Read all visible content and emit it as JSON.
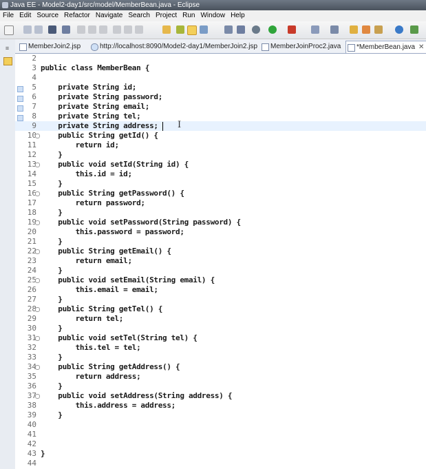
{
  "window": {
    "title": "Java EE - Model2-day1/src/model/MemberBean.java - Eclipse"
  },
  "menu": [
    "File",
    "Edit",
    "Source",
    "Refactor",
    "Navigate",
    "Search",
    "Project",
    "Run",
    "Window",
    "Help"
  ],
  "tabs": [
    {
      "label": "MemberJoin2.jsp",
      "active": false,
      "icon": "jsp-file-icon"
    },
    {
      "label": "http://localhost:8090/Model2-day1/MemberJoin2.jsp",
      "active": false,
      "icon": "web-browser-icon"
    },
    {
      "label": "MemberJoinProc2.java",
      "active": false,
      "icon": "java-file-icon"
    },
    {
      "label": "*MemberBean.java",
      "active": true,
      "icon": "java-file-icon",
      "close": "✕"
    }
  ],
  "colors": {
    "keyword": "#1a1a1a",
    "line_numbers": "#6a6a6a",
    "current_line": "#e8f2fe",
    "titlebar": "#4a525d"
  },
  "editor": {
    "current_line": 9,
    "lines": [
      {
        "n": "2",
        "code": ""
      },
      {
        "n": "3",
        "code": "public class MemberBean {"
      },
      {
        "n": "4",
        "code": ""
      },
      {
        "n": "5",
        "code": "    private String id;"
      },
      {
        "n": "6",
        "code": "    private String password;"
      },
      {
        "n": "7",
        "code": "    private String email;"
      },
      {
        "n": "8",
        "code": "    private String tel;"
      },
      {
        "n": "9",
        "code": "    private String address;"
      },
      {
        "n": "10",
        "code": "    public String getId() {",
        "fold": true
      },
      {
        "n": "11",
        "code": "        return id;"
      },
      {
        "n": "12",
        "code": "    }"
      },
      {
        "n": "13",
        "code": "    public void setId(String id) {",
        "fold": true
      },
      {
        "n": "14",
        "code": "        this.id = id;"
      },
      {
        "n": "15",
        "code": "    }"
      },
      {
        "n": "16",
        "code": "    public String getPassword() {",
        "fold": true
      },
      {
        "n": "17",
        "code": "        return password;"
      },
      {
        "n": "18",
        "code": "    }"
      },
      {
        "n": "19",
        "code": "    public void setPassword(String password) {",
        "fold": true
      },
      {
        "n": "20",
        "code": "        this.password = password;"
      },
      {
        "n": "21",
        "code": "    }"
      },
      {
        "n": "22",
        "code": "    public String getEmail() {",
        "fold": true
      },
      {
        "n": "23",
        "code": "        return email;"
      },
      {
        "n": "24",
        "code": "    }"
      },
      {
        "n": "25",
        "code": "    public void setEmail(String email) {",
        "fold": true
      },
      {
        "n": "26",
        "code": "        this.email = email;"
      },
      {
        "n": "27",
        "code": "    }"
      },
      {
        "n": "28",
        "code": "    public String getTel() {",
        "fold": true
      },
      {
        "n": "29",
        "code": "        return tel;"
      },
      {
        "n": "30",
        "code": "    }"
      },
      {
        "n": "31",
        "code": "    public void setTel(String tel) {",
        "fold": true
      },
      {
        "n": "32",
        "code": "        this.tel = tel;"
      },
      {
        "n": "33",
        "code": "    }"
      },
      {
        "n": "34",
        "code": "    public String getAddress() {",
        "fold": true
      },
      {
        "n": "35",
        "code": "        return address;"
      },
      {
        "n": "36",
        "code": "    }"
      },
      {
        "n": "37",
        "code": "    public void setAddress(String address) {",
        "fold": true
      },
      {
        "n": "38",
        "code": "        this.address = address;"
      },
      {
        "n": "39",
        "code": "    }"
      },
      {
        "n": "40",
        "code": ""
      },
      {
        "n": "41",
        "code": ""
      },
      {
        "n": "42",
        "code": ""
      },
      {
        "n": "43",
        "code": "}"
      },
      {
        "n": "44",
        "code": ""
      }
    ]
  }
}
